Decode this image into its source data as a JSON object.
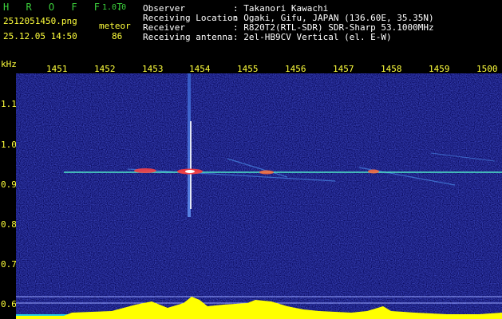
{
  "header": {
    "app_title": "H R O F F T",
    "version": "1.0.0",
    "filename": "2512051450.png",
    "datetime": "25.12.05 14:50",
    "detector_label": "meteor",
    "detector_count": "86",
    "fields": [
      {
        "label": "Observer",
        "value": ": Takanori Kawachi"
      },
      {
        "label": "Receiving Location",
        "value": ": Ogaki, Gifu, JAPAN (136.60E, 35.35N)"
      },
      {
        "label": "Receiver",
        "value": ": R820T2(RTL-SDR) SDR-Sharp 53.1000MHz"
      },
      {
        "label": "Receiving antenna",
        "value": ": 2el-HB9CV Vertical (el. E-W)"
      }
    ]
  },
  "axis": {
    "y_unit": "kHz",
    "x_ticks": [
      "1451",
      "1452",
      "1453",
      "1454",
      "1455",
      "1456",
      "1457",
      "1458",
      "1459",
      "1500"
    ],
    "y_ticks": [
      "1.1",
      "1.0",
      "0.9",
      "0.8",
      "0.7",
      "0.6"
    ]
  },
  "colors": {
    "background": "#000000",
    "spectrogram": "#0a0a6e",
    "header_text": "#ffffff",
    "title_green": "#3cd23c",
    "axis_yellow": "#ffff3c",
    "carrier": "#50e8c8"
  }
}
